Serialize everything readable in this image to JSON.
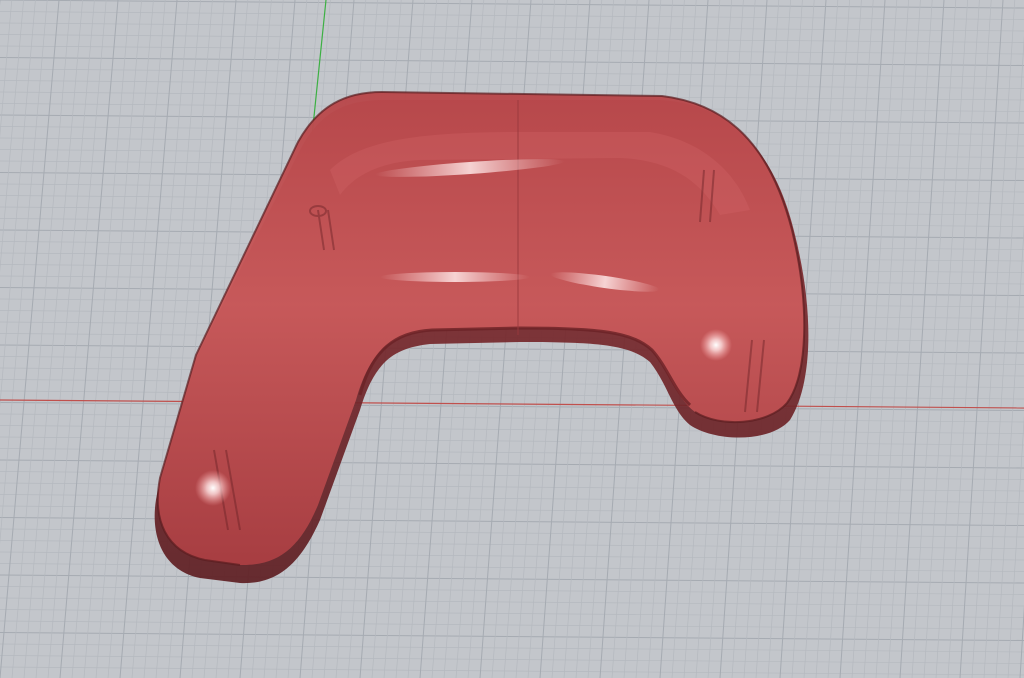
{
  "viewport": {
    "background_color": "#c3c6cb",
    "grid_minor_color": "#b5b9bf",
    "grid_major_color": "#a6abb2",
    "x_axis_color": "#c0504d",
    "y_axis_color": "#3cb043",
    "object": {
      "name": "controller-shell",
      "base_color": "#c25354",
      "dark_color": "#7a2a2c",
      "highlight_color": "#ffffff",
      "material": "translucent"
    }
  }
}
